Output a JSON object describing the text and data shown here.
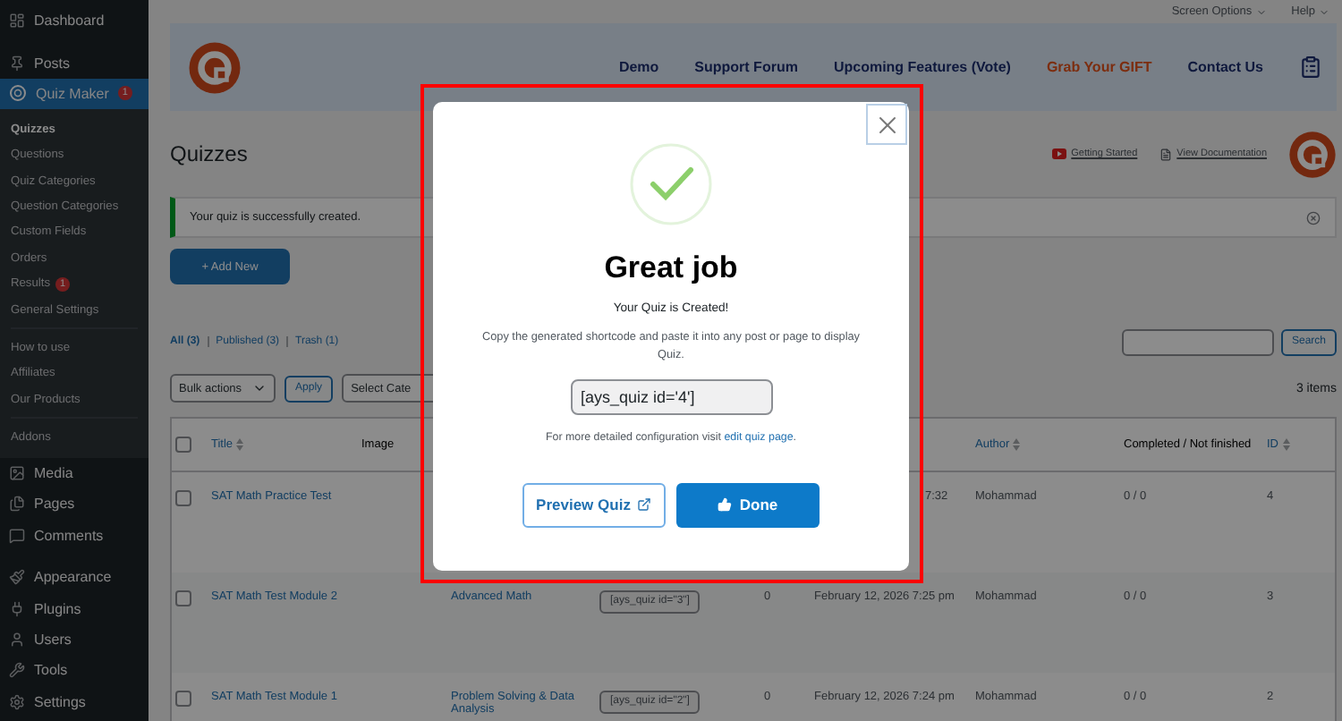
{
  "top_bar": {
    "links": [
      "Screen Options",
      "Help"
    ]
  },
  "sidebar": {
    "items": [
      {
        "label": "Dashboard",
        "selected": false
      },
      {
        "label": "Posts",
        "selected": false
      },
      {
        "label": "Quiz Maker",
        "selected": true,
        "badge": "1",
        "submenu_groups": [
          {
            "items": [
              {
                "label": "Quizzes",
                "selected": true
              },
              {
                "label": "Questions",
                "selected": false
              },
              {
                "label": "Quiz Categories",
                "selected": false
              },
              {
                "label": "Question Categories",
                "selected": false
              },
              {
                "label": "Custom Fields",
                "selected": false
              },
              {
                "label": "Orders",
                "selected": false
              },
              {
                "label": "Results",
                "selected": false,
                "badge": "1"
              },
              {
                "label": "General Settings",
                "selected": false
              }
            ]
          },
          {
            "items": [
              {
                "label": "How to use",
                "selected": false
              },
              {
                "label": "Affiliates",
                "selected": false
              },
              {
                "label": "Our Products",
                "selected": false
              }
            ]
          },
          {
            "items": [
              {
                "label": "Addons",
                "selected": false
              }
            ]
          }
        ]
      },
      {
        "label": "Media",
        "selected": false
      },
      {
        "label": "Pages",
        "selected": false
      },
      {
        "label": "Comments",
        "selected": false
      },
      {
        "label": "Appearance",
        "selected": false
      },
      {
        "label": "Plugins",
        "selected": false
      },
      {
        "label": "Users",
        "selected": false
      },
      {
        "label": "Tools",
        "selected": false
      },
      {
        "label": "Settings",
        "selected": false
      }
    ]
  },
  "banner": {
    "links": [
      {
        "label": "Demo",
        "kind": "normal"
      },
      {
        "label": "Support Forum",
        "kind": "normal"
      },
      {
        "label": "Upcoming Features (Vote)",
        "kind": "normal"
      },
      {
        "label": "Grab Your GIFT",
        "kind": "accent"
      },
      {
        "label": "Contact Us",
        "kind": "normal"
      }
    ]
  },
  "page_title": "Quizzes",
  "help_links": [
    "Getting Started",
    "View Documentation"
  ],
  "notice": "Your quiz is successfully created.",
  "add_new": "+ Add New",
  "filters": [
    {
      "label": "All (3)",
      "selected": true
    },
    {
      "label": "Published (3)",
      "selected": false
    },
    {
      "label": "Trash (1)",
      "selected": false
    }
  ],
  "search_button": "Search",
  "bulk_actions": "Bulk actions",
  "apply": "Apply",
  "category_select": "Select Cate",
  "item_count": "3 items",
  "table": {
    "columns": [
      "Title",
      "Image",
      "Author",
      "Completed / Not finished",
      "ID"
    ],
    "select_all_checked": false,
    "rows": [
      {
        "checked": false,
        "title": "SAT Math Practice Test",
        "date": "7:32",
        "author": "Mohammad",
        "completed": "0 / 0",
        "id": "4"
      },
      {
        "checked": false,
        "title": "SAT Math Test Module 2",
        "category": "Advanced Math",
        "shortcode": "[ays_quiz id=\"3\"]",
        "count": "0",
        "date": "February 12, 2026 7:25 pm",
        "author": "Mohammad",
        "completed": "0 / 0",
        "id": "3"
      },
      {
        "checked": false,
        "title": "SAT Math Test Module 1",
        "category": "Problem Solving & Data Analysis",
        "shortcode": "[ays_quiz id=\"2\"]",
        "count": "0",
        "date": "February 12, 2026 7:24 pm",
        "author": "Mohammad",
        "completed": "0 / 0",
        "id": "2"
      }
    ]
  },
  "modal": {
    "title": "Great job",
    "subtitle": "Your Quiz is Created!",
    "description": "Copy the generated shortcode and paste it into any post or page to display Quiz.",
    "shortcode": "[ays_quiz id='4']",
    "config_text": "For more detailed configuration visit",
    "config_link": "edit quiz page",
    "config_end": ".",
    "preview_button": "Preview Quiz",
    "done_button": "Done"
  }
}
